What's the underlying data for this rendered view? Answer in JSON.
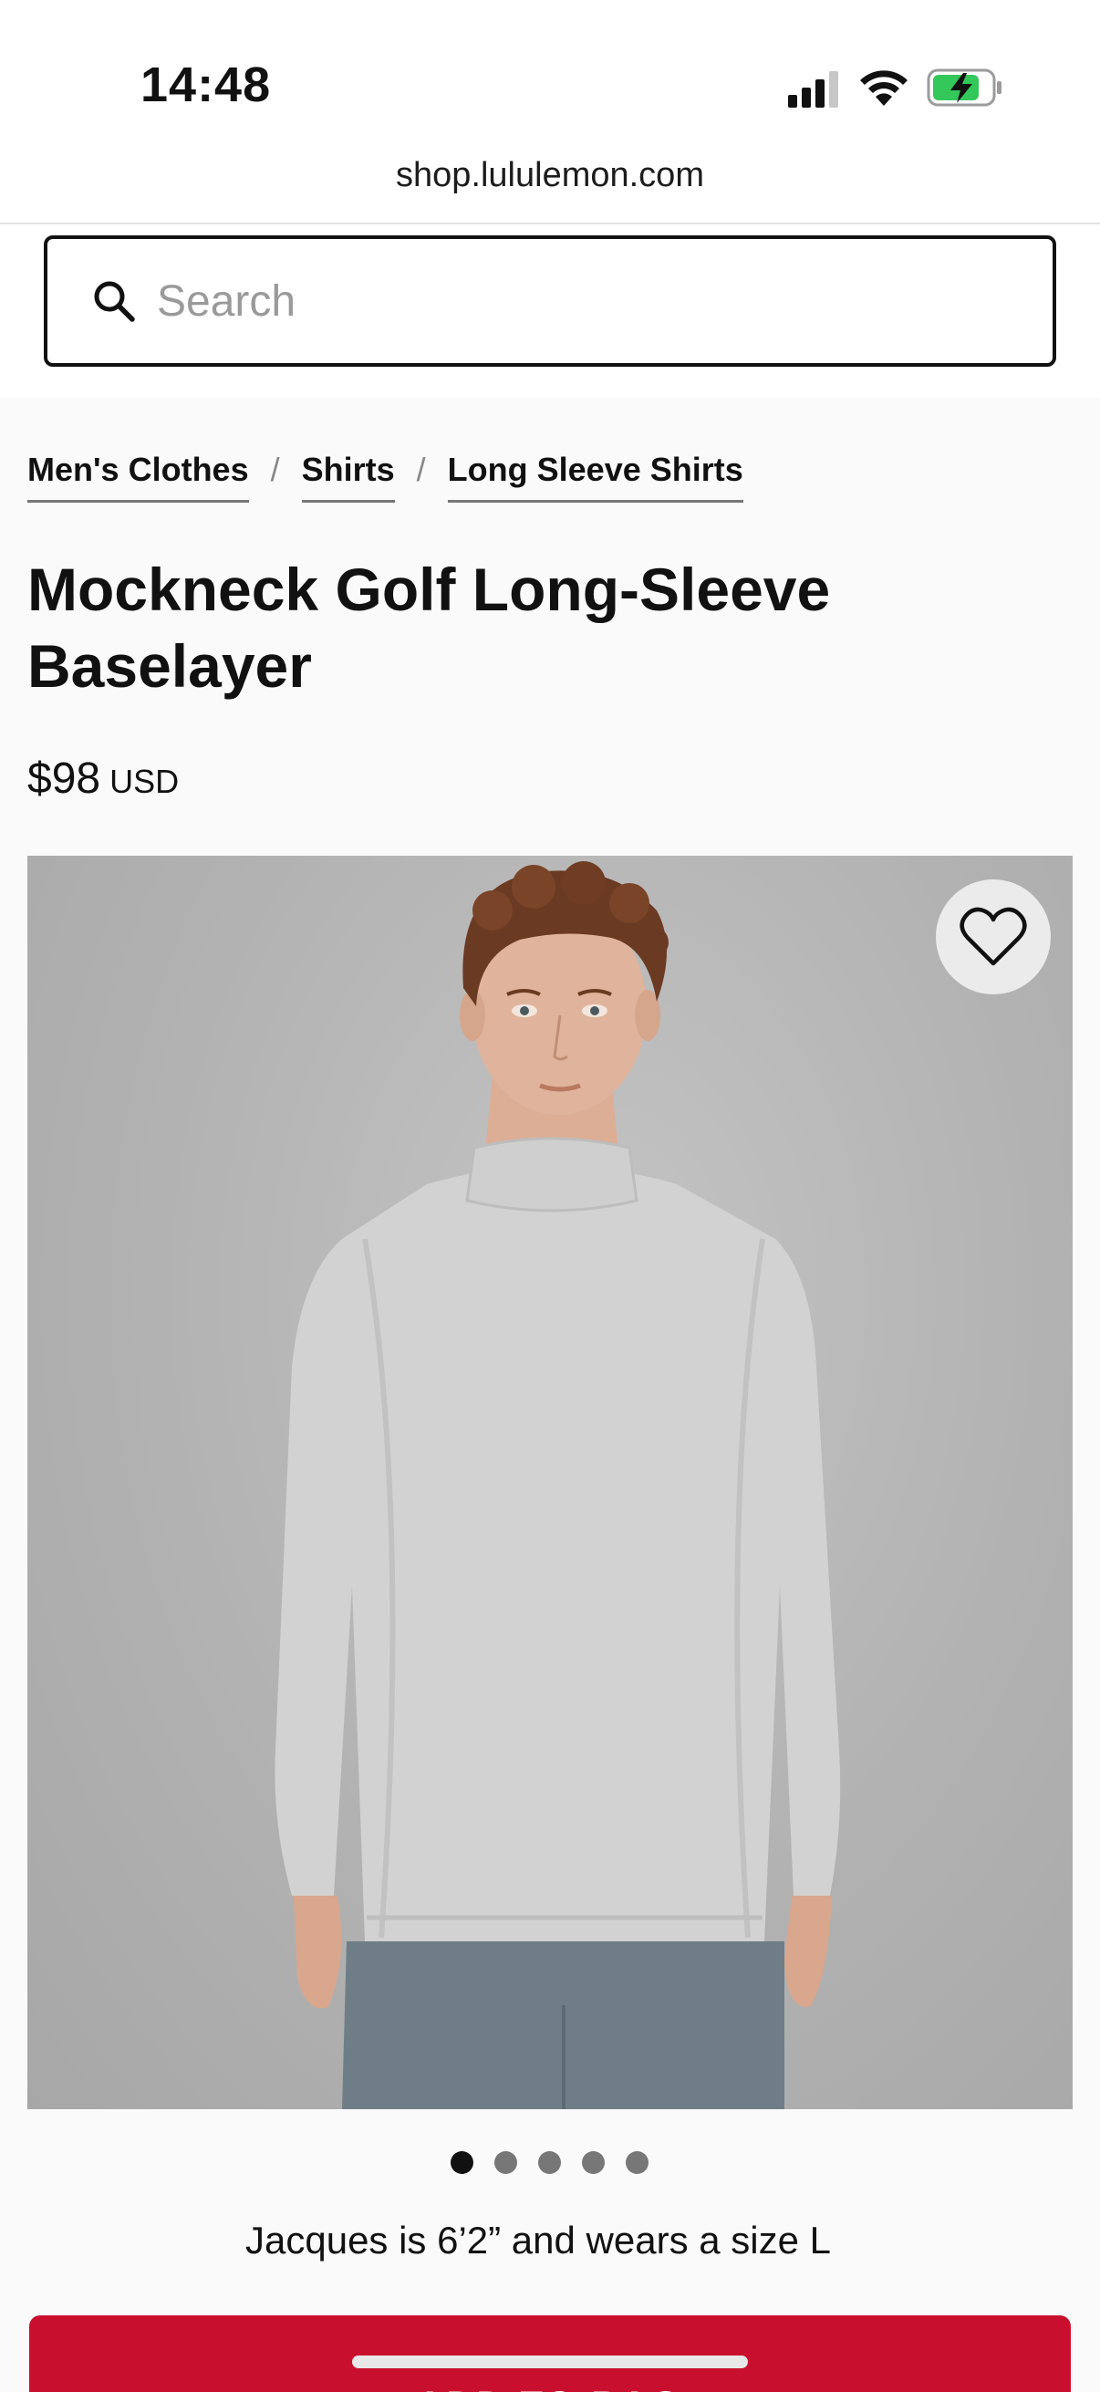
{
  "status_bar": {
    "time": "14:48",
    "icons": [
      "signal-icon",
      "wifi-icon",
      "battery-charging-icon"
    ]
  },
  "browser": {
    "url": "shop.lululemon.com"
  },
  "search": {
    "placeholder": "Search",
    "value": "",
    "icon": "search-icon"
  },
  "breadcrumb": {
    "items": [
      "Men's Clothes",
      "Shirts",
      "Long Sleeve Shirts"
    ],
    "separator": "/"
  },
  "product": {
    "title": "Mockneck Golf Long-Sleeve Baselayer",
    "price": "$98",
    "currency": "USD",
    "wishlist_icon": "heart-icon",
    "image_count": 5,
    "active_image": 1,
    "model_note": "Jacques is 6’2” and wears a size L"
  },
  "actions": {
    "add_to_bag": "ADD TO BAG"
  },
  "colors": {
    "accent": "#c8102e",
    "battery_charging": "#34c759"
  }
}
